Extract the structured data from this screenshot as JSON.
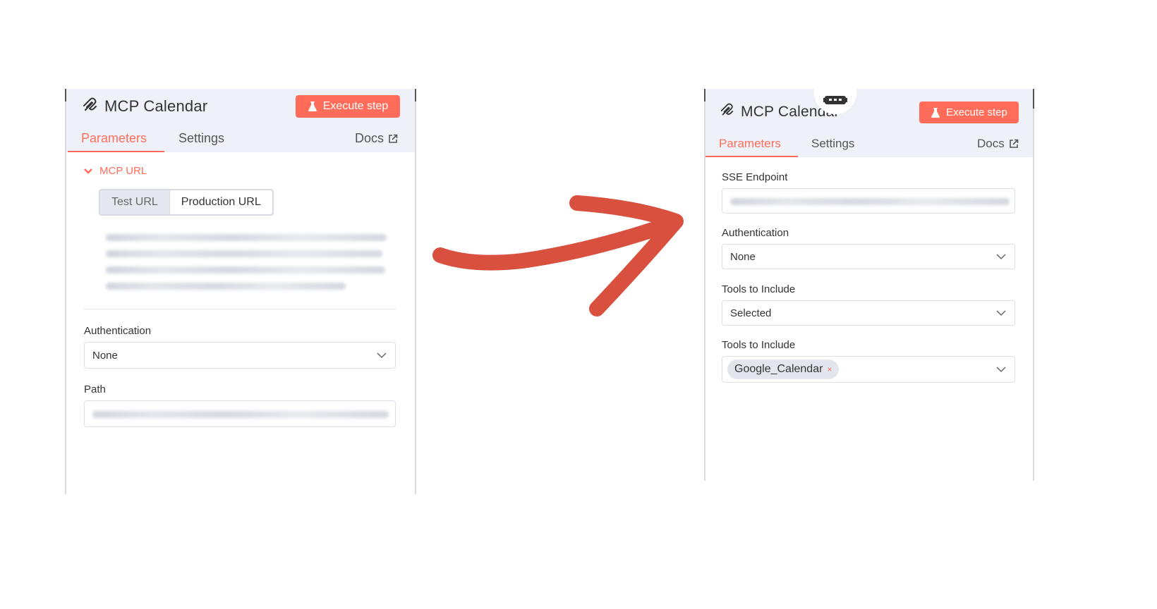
{
  "left_panel": {
    "title": "MCP Calendar",
    "execute_label": "Execute step",
    "tabs": [
      "Parameters",
      "Settings"
    ],
    "docs_label": "Docs",
    "mcp_url_label": "MCP URL",
    "url_toggle": {
      "test": "Test URL",
      "production": "Production URL",
      "selected": "Production URL"
    },
    "authentication_label": "Authentication",
    "authentication_value": "None",
    "path_label": "Path"
  },
  "right_panel": {
    "title": "MCP Calendar",
    "execute_label": "Execute step",
    "tabs": [
      "Parameters",
      "Settings"
    ],
    "docs_label": "Docs",
    "sse_label": "SSE Endpoint",
    "authentication_label": "Authentication",
    "authentication_value": "None",
    "tools_label_1": "Tools to Include",
    "tools_value": "Selected",
    "tools_label_2": "Tools to Include",
    "tools_tag": "Google_Calendar",
    "tag_remove": "×"
  },
  "colors": {
    "accent": "#ff6d5a",
    "header_bg": "#eff1f8",
    "arrow": "#d9503f"
  },
  "icons": {
    "node": "mcp-node-icon",
    "execute": "flask-icon",
    "docs": "external-link-icon",
    "chevron": "chevron-down-icon",
    "collapse": "caret-down-icon",
    "badge": "robot-icon",
    "transition": "curved-arrow-icon"
  }
}
